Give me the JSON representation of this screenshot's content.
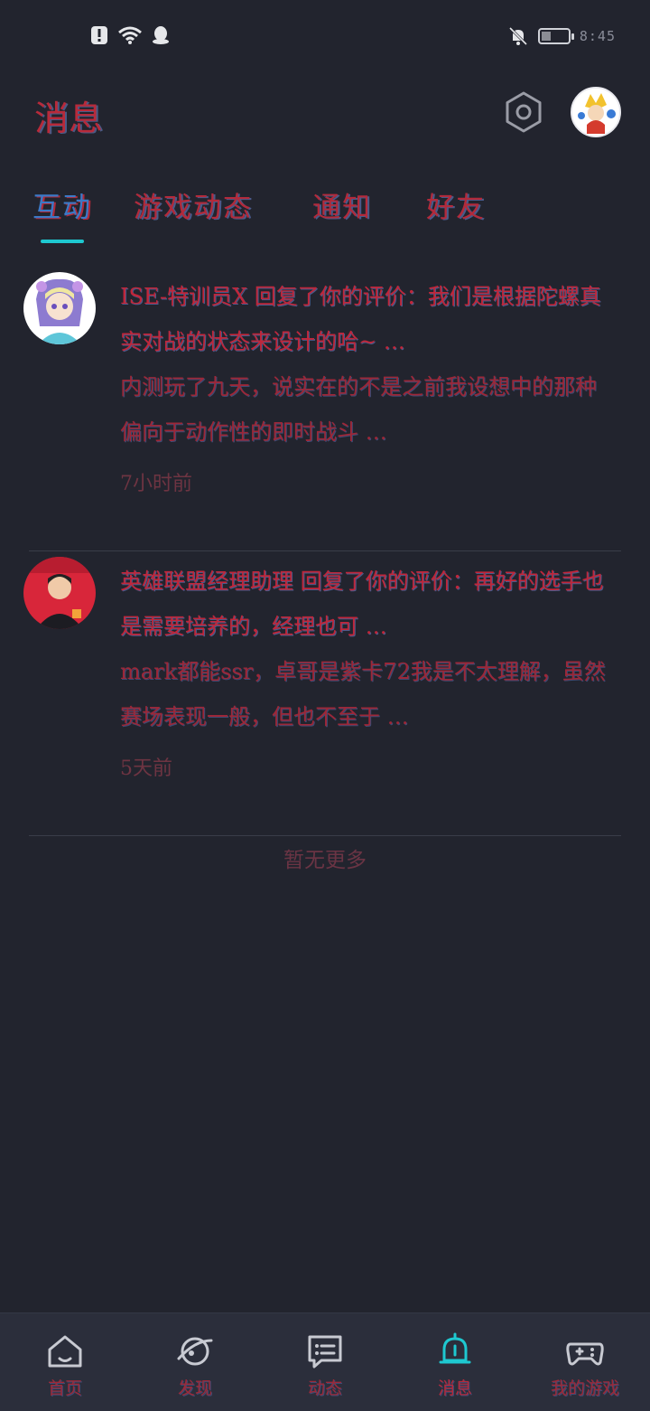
{
  "status_bar": {
    "time": "8:45",
    "icons": [
      "alert-icon",
      "wifi-icon",
      "qq-icon",
      "mute-bell-icon",
      "battery-icon"
    ],
    "battery_percent": 45
  },
  "header": {
    "title": "消息"
  },
  "tabs": [
    {
      "label": "互动",
      "active": true
    },
    {
      "label": "游戏动态",
      "active": false
    },
    {
      "label": "通知",
      "active": false
    },
    {
      "label": "好友",
      "active": false
    }
  ],
  "messages": [
    {
      "title": "ISE-特训员X 回复了你的评价：我们是根据陀螺真实对战的状态来设计的哈~ …",
      "preview": "内测玩了九天，说实在的不是之前我设想中的那种偏向于动作性的即时战斗 …",
      "time": "7小时前"
    },
    {
      "title": "英雄联盟经理助理 回复了你的评价：再好的选手也是需要培养的，经理也可 …",
      "preview": "mark都能ssr，卓哥是紫卡72我是不太理解，虽然赛场表现一般，但也不至于 …",
      "time": "5天前"
    }
  ],
  "list_footer": "暂无更多",
  "bottom_nav": [
    {
      "label": "首页",
      "icon": "home-icon",
      "active": false
    },
    {
      "label": "发现",
      "icon": "planet-icon",
      "active": false
    },
    {
      "label": "动态",
      "icon": "chat-icon",
      "active": false
    },
    {
      "label": "消息",
      "icon": "bell-icon",
      "active": true
    },
    {
      "label": "我的游戏",
      "icon": "gamepad-icon",
      "active": false
    }
  ],
  "colors": {
    "background": "#22242e",
    "accent": "#1ec8d0",
    "text": "#c0263a"
  }
}
